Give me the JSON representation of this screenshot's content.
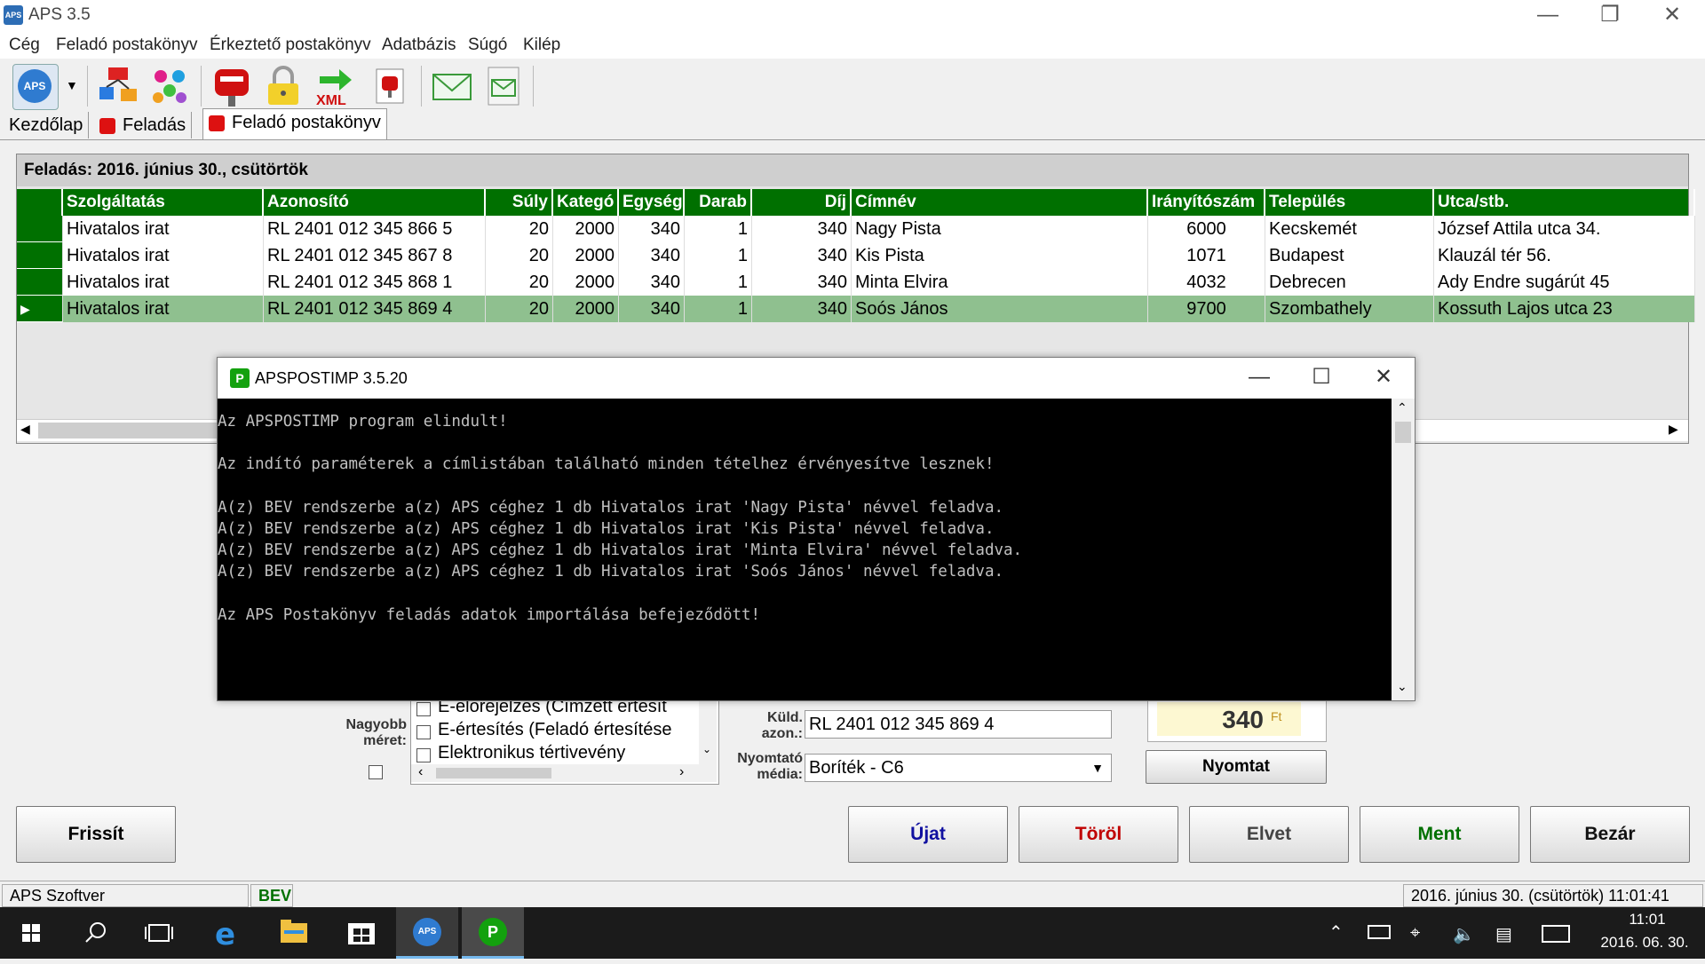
{
  "window": {
    "title": "APS 3.5",
    "app_icon": "APS"
  },
  "menu": [
    "Cég",
    "Feladó postakönyv",
    "Érkeztető postakönyv",
    "Adatbázis",
    "Súgó",
    "Kilép"
  ],
  "tabs": [
    "Kezdőlap",
    "Feladás",
    "Feladó postakönyv"
  ],
  "grid": {
    "caption": "Feladás: 2016. június 30., csütörtök",
    "headers": [
      "Szolgáltatás",
      "Azonosító",
      "Súly",
      "Kategó",
      "Egység",
      "Darab",
      "Díj",
      "Címnév",
      "Irányítószám",
      "Település",
      "Utca/stb."
    ],
    "rows": [
      [
        "Hivatalos irat",
        "RL 2401 012 345 866 5",
        "20",
        "2000",
        "340",
        "1",
        "340",
        "Nagy Pista",
        "6000",
        "Kecskemét",
        "József Attila utca 34."
      ],
      [
        "Hivatalos irat",
        "RL 2401 012 345 867 8",
        "20",
        "2000",
        "340",
        "1",
        "340",
        "Kis Pista",
        "1071",
        "Budapest",
        "Klauzál tér 56."
      ],
      [
        "Hivatalos irat",
        "RL 2401 012 345 868 1",
        "20",
        "2000",
        "340",
        "1",
        "340",
        "Minta Elvira",
        "4032",
        "Debrecen",
        "Ady Endre sugárút 45"
      ],
      [
        "Hivatalos irat",
        "RL 2401 012 345 869 4",
        "20",
        "2000",
        "340",
        "1",
        "340",
        "Soós János",
        "9700",
        "Szombathely",
        "Kossuth Lajos utca 23"
      ]
    ],
    "selected_row": 3,
    "row_marker": "▶",
    "scroll_left": "◀",
    "scroll_right": "▶"
  },
  "console": {
    "title": "APSPOSTIMP 3.5.20",
    "icon_letter": "P",
    "lines": [
      "Az APSPOSTIMP program elindult!",
      "",
      "Az indító paraméterek a címlistában található minden tételhez érvényesítve lesznek!",
      "",
      "A(z) BEV rendszerbe a(z) APS céghez 1 db Hivatalos irat 'Nagy Pista' névvel feladva.",
      "A(z) BEV rendszerbe a(z) APS céghez 1 db Hivatalos irat 'Kis Pista' névvel feladva.",
      "A(z) BEV rendszerbe a(z) APS céghez 1 db Hivatalos irat 'Minta Elvira' névvel feladva.",
      "A(z) BEV rendszerbe a(z) APS céghez 1 db Hivatalos irat 'Soós János' névvel feladva.",
      "",
      "Az APS Postakönyv feladás adatok importálása befejeződött!"
    ]
  },
  "form": {
    "nagyobb_meret_label1": "Nagyobb",
    "nagyobb_meret_label2": "méret:",
    "options": [
      "E-előrejelzés (Címzett értesít",
      "E-értesítés (Feladó értesítése",
      "Elektronikus tértivevény"
    ],
    "kuld_azon_label1": "Küld.",
    "kuld_azon_label2": "azon.:",
    "kuld_azon_value": "RL 2401 012 345 869 4",
    "nyomtato_label1": "Nyomtató",
    "nyomtato_label2": "média:",
    "nyomtato_value": "Boríték - C6",
    "price_value": "340",
    "price_unit": "Ft",
    "nyomtat_button": "Nyomtat"
  },
  "buttons": {
    "frissit": "Frissít",
    "ujat": "Újat",
    "torol": "Töröl",
    "elvet": "Elvet",
    "ment": "Ment",
    "bezar": "Bezár"
  },
  "status": {
    "company": "APS Szoftver",
    "mode": "BEV",
    "datetime": "2016. június 30. (csütörtök) 11:01:41"
  },
  "taskbar": {
    "time": "11:01",
    "date": "2016. 06. 30."
  },
  "colors": {
    "grid_header": "#007000",
    "selected_row": "#8fc08f",
    "console_bg": "#000000",
    "price_bg": "#fdf8d2"
  }
}
